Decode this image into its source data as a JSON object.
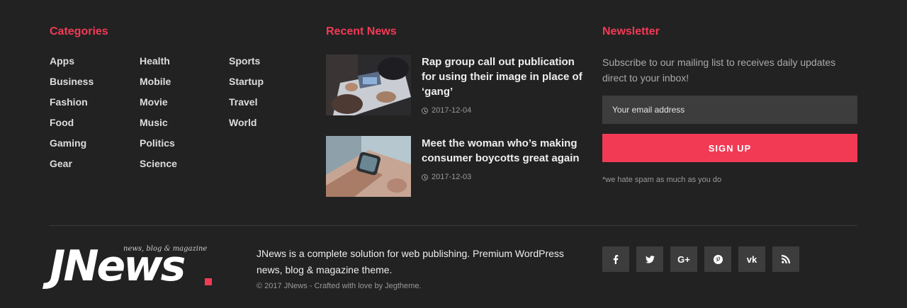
{
  "categories": {
    "title": "Categories",
    "col1": [
      "Apps",
      "Business",
      "Fashion",
      "Food",
      "Gaming",
      "Gear"
    ],
    "col2": [
      "Health",
      "Mobile",
      "Movie",
      "Music",
      "Politics",
      "Science"
    ],
    "col3": [
      "Sports",
      "Startup",
      "Travel",
      "World"
    ]
  },
  "recent_news": {
    "title": "Recent News",
    "items": [
      {
        "title": "Rap group call out publication for using their image in place of ‘gang’",
        "date": "2017-12-04",
        "thumb": "meeting-photo"
      },
      {
        "title": "Meet the woman who’s making consumer boycotts great again",
        "date": "2017-12-03",
        "thumb": "smartwatch-photo"
      }
    ]
  },
  "newsletter": {
    "title": "Newsletter",
    "description": "Subscribe to our mailing list to receives daily updates direct to your inbox!",
    "placeholder": "Your email address",
    "button": "SIGN UP",
    "note": "*we hate spam as much as you do"
  },
  "footer": {
    "logo_text": "JNews",
    "logo_tagline": "news, blog & magazine",
    "about": "JNews is a complete solution for web publishing. Premium WordPress news, blog & magazine theme.",
    "copyright": "© 2017 JNews - Crafted with love by Jegtheme.",
    "socials": [
      {
        "name": "facebook",
        "glyph": "f"
      },
      {
        "name": "twitter",
        "glyph": "t"
      },
      {
        "name": "google-plus",
        "glyph": "G+"
      },
      {
        "name": "pinterest",
        "glyph": "p"
      },
      {
        "name": "vk",
        "glyph": "vk"
      },
      {
        "name": "rss",
        "glyph": "rss"
      }
    ]
  },
  "colors": {
    "accent": "#f23a55",
    "background": "#222222",
    "surface": "#3d3d3d"
  }
}
